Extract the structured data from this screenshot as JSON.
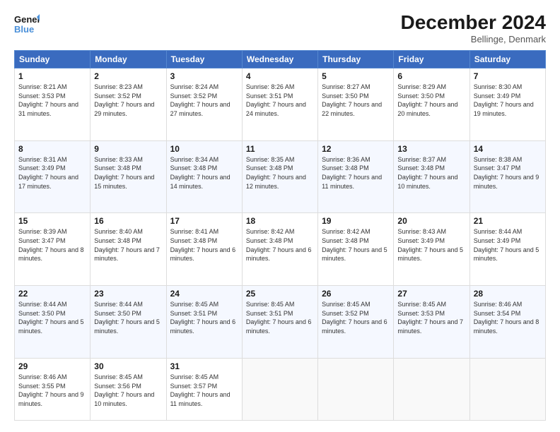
{
  "header": {
    "logo_line1": "General",
    "logo_line2": "Blue",
    "month": "December 2024",
    "location": "Bellinge, Denmark"
  },
  "days_of_week": [
    "Sunday",
    "Monday",
    "Tuesday",
    "Wednesday",
    "Thursday",
    "Friday",
    "Saturday"
  ],
  "weeks": [
    [
      {
        "day": "1",
        "sunrise": "8:21 AM",
        "sunset": "3:53 PM",
        "daylight": "7 hours and 31 minutes."
      },
      {
        "day": "2",
        "sunrise": "8:23 AM",
        "sunset": "3:52 PM",
        "daylight": "7 hours and 29 minutes."
      },
      {
        "day": "3",
        "sunrise": "8:24 AM",
        "sunset": "3:52 PM",
        "daylight": "7 hours and 27 minutes."
      },
      {
        "day": "4",
        "sunrise": "8:26 AM",
        "sunset": "3:51 PM",
        "daylight": "7 hours and 24 minutes."
      },
      {
        "day": "5",
        "sunrise": "8:27 AM",
        "sunset": "3:50 PM",
        "daylight": "7 hours and 22 minutes."
      },
      {
        "day": "6",
        "sunrise": "8:29 AM",
        "sunset": "3:50 PM",
        "daylight": "7 hours and 20 minutes."
      },
      {
        "day": "7",
        "sunrise": "8:30 AM",
        "sunset": "3:49 PM",
        "daylight": "7 hours and 19 minutes."
      }
    ],
    [
      {
        "day": "8",
        "sunrise": "8:31 AM",
        "sunset": "3:49 PM",
        "daylight": "7 hours and 17 minutes."
      },
      {
        "day": "9",
        "sunrise": "8:33 AM",
        "sunset": "3:48 PM",
        "daylight": "7 hours and 15 minutes."
      },
      {
        "day": "10",
        "sunrise": "8:34 AM",
        "sunset": "3:48 PM",
        "daylight": "7 hours and 14 minutes."
      },
      {
        "day": "11",
        "sunrise": "8:35 AM",
        "sunset": "3:48 PM",
        "daylight": "7 hours and 12 minutes."
      },
      {
        "day": "12",
        "sunrise": "8:36 AM",
        "sunset": "3:48 PM",
        "daylight": "7 hours and 11 minutes."
      },
      {
        "day": "13",
        "sunrise": "8:37 AM",
        "sunset": "3:48 PM",
        "daylight": "7 hours and 10 minutes."
      },
      {
        "day": "14",
        "sunrise": "8:38 AM",
        "sunset": "3:47 PM",
        "daylight": "7 hours and 9 minutes."
      }
    ],
    [
      {
        "day": "15",
        "sunrise": "8:39 AM",
        "sunset": "3:47 PM",
        "daylight": "7 hours and 8 minutes."
      },
      {
        "day": "16",
        "sunrise": "8:40 AM",
        "sunset": "3:48 PM",
        "daylight": "7 hours and 7 minutes."
      },
      {
        "day": "17",
        "sunrise": "8:41 AM",
        "sunset": "3:48 PM",
        "daylight": "7 hours and 6 minutes."
      },
      {
        "day": "18",
        "sunrise": "8:42 AM",
        "sunset": "3:48 PM",
        "daylight": "7 hours and 6 minutes."
      },
      {
        "day": "19",
        "sunrise": "8:42 AM",
        "sunset": "3:48 PM",
        "daylight": "7 hours and 5 minutes."
      },
      {
        "day": "20",
        "sunrise": "8:43 AM",
        "sunset": "3:49 PM",
        "daylight": "7 hours and 5 minutes."
      },
      {
        "day": "21",
        "sunrise": "8:44 AM",
        "sunset": "3:49 PM",
        "daylight": "7 hours and 5 minutes."
      }
    ],
    [
      {
        "day": "22",
        "sunrise": "8:44 AM",
        "sunset": "3:50 PM",
        "daylight": "7 hours and 5 minutes."
      },
      {
        "day": "23",
        "sunrise": "8:44 AM",
        "sunset": "3:50 PM",
        "daylight": "7 hours and 5 minutes."
      },
      {
        "day": "24",
        "sunrise": "8:45 AM",
        "sunset": "3:51 PM",
        "daylight": "7 hours and 6 minutes."
      },
      {
        "day": "25",
        "sunrise": "8:45 AM",
        "sunset": "3:51 PM",
        "daylight": "7 hours and 6 minutes."
      },
      {
        "day": "26",
        "sunrise": "8:45 AM",
        "sunset": "3:52 PM",
        "daylight": "7 hours and 6 minutes."
      },
      {
        "day": "27",
        "sunrise": "8:45 AM",
        "sunset": "3:53 PM",
        "daylight": "7 hours and 7 minutes."
      },
      {
        "day": "28",
        "sunrise": "8:46 AM",
        "sunset": "3:54 PM",
        "daylight": "7 hours and 8 minutes."
      }
    ],
    [
      {
        "day": "29",
        "sunrise": "8:46 AM",
        "sunset": "3:55 PM",
        "daylight": "7 hours and 9 minutes."
      },
      {
        "day": "30",
        "sunrise": "8:45 AM",
        "sunset": "3:56 PM",
        "daylight": "7 hours and 10 minutes."
      },
      {
        "day": "31",
        "sunrise": "8:45 AM",
        "sunset": "3:57 PM",
        "daylight": "7 hours and 11 minutes."
      },
      null,
      null,
      null,
      null
    ]
  ]
}
